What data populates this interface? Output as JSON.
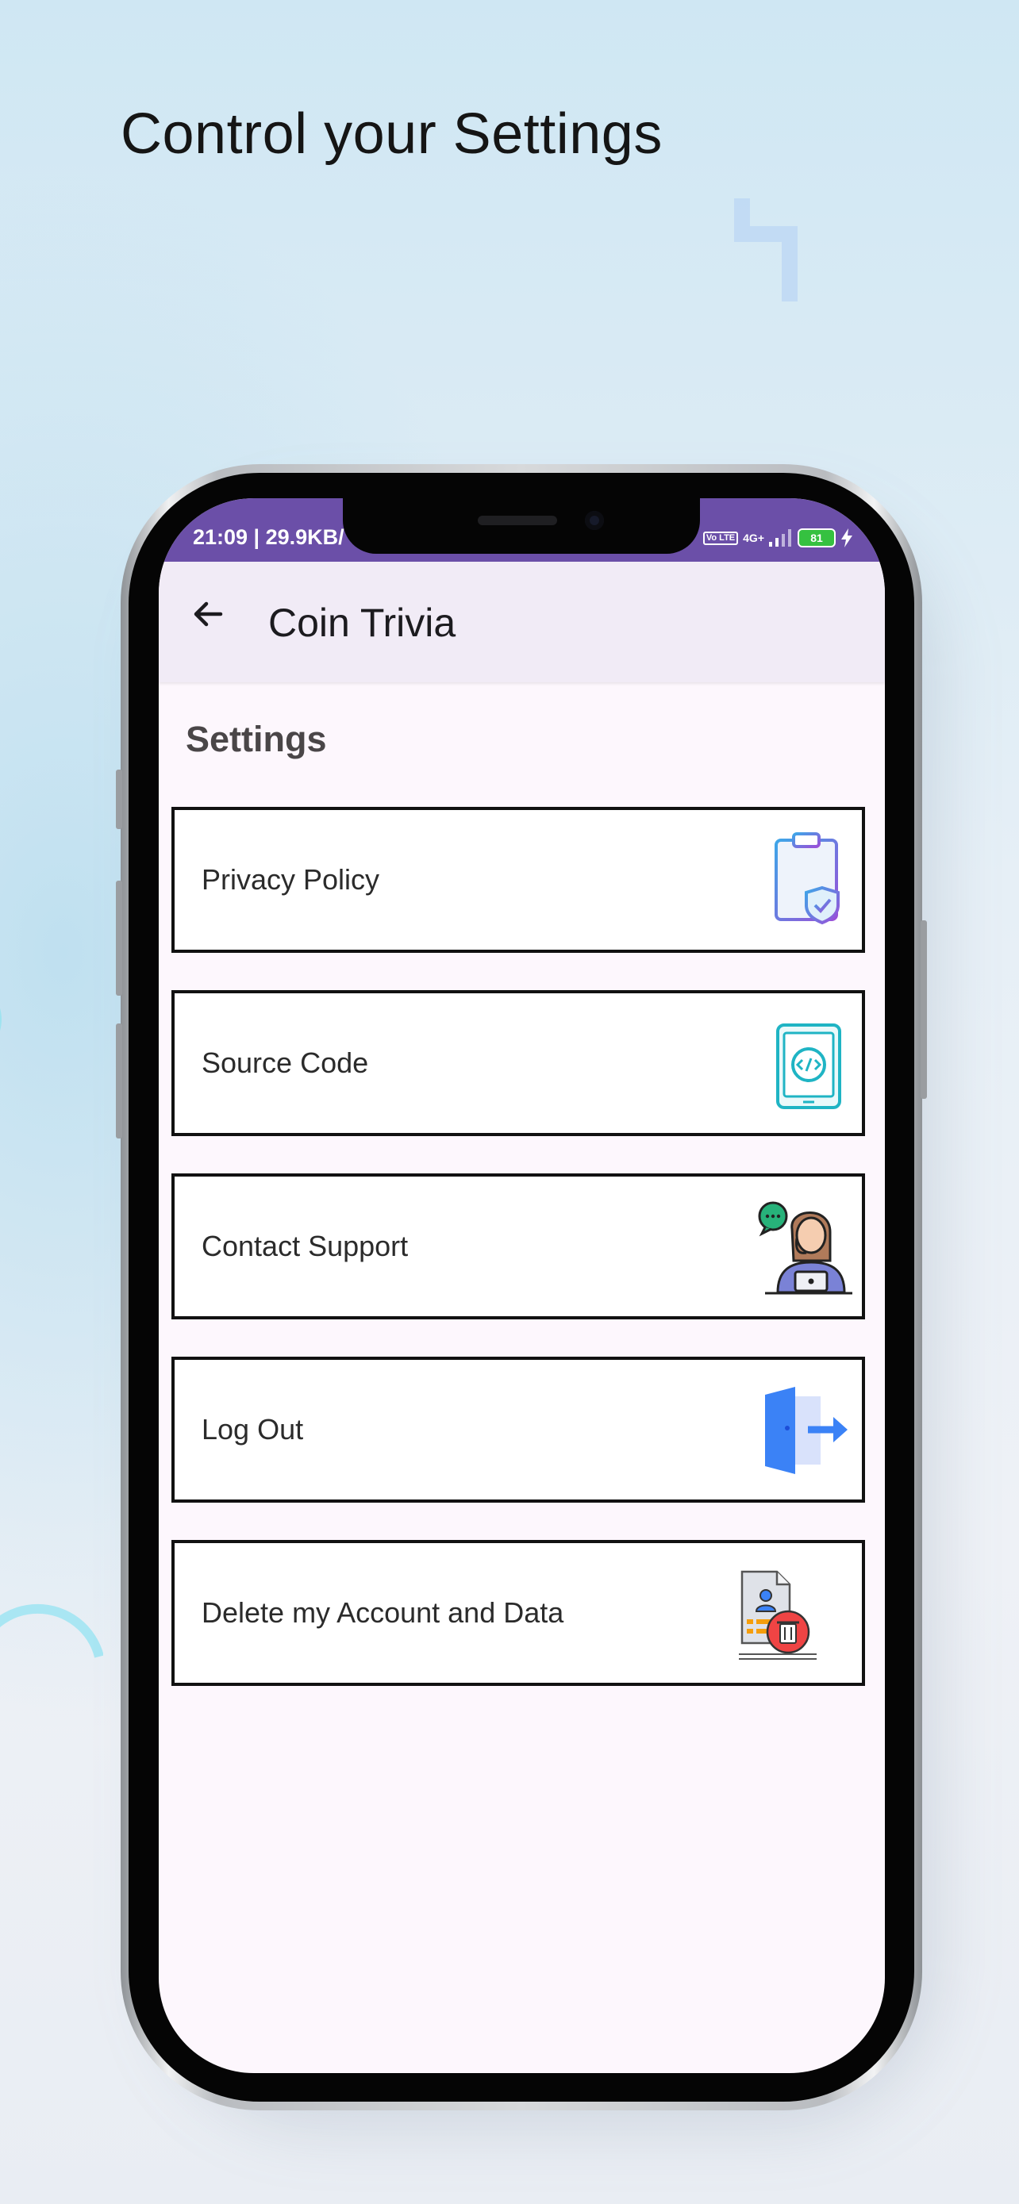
{
  "headline": "Control your Settings",
  "status_bar": {
    "time": "21:09 | 29.9KB/",
    "volte": "Vo LTE",
    "network": "4G+",
    "battery": "81"
  },
  "app_bar": {
    "title": "Coin Trivia"
  },
  "section_title": "Settings",
  "settings_items": [
    {
      "label": "Privacy Policy",
      "icon": "privacy-policy-icon"
    },
    {
      "label": "Source Code",
      "icon": "source-code-icon"
    },
    {
      "label": "Contact Support",
      "icon": "contact-support-icon"
    },
    {
      "label": "Log Out",
      "icon": "log-out-icon"
    },
    {
      "label": "Delete my Account and Data",
      "icon": "delete-account-icon"
    }
  ],
  "colors": {
    "status_bar": "#6b4fa8",
    "app_bar": "#f1ebf6",
    "screen_bg": "#fdf7fd",
    "accent_blue": "#3b82f6"
  }
}
